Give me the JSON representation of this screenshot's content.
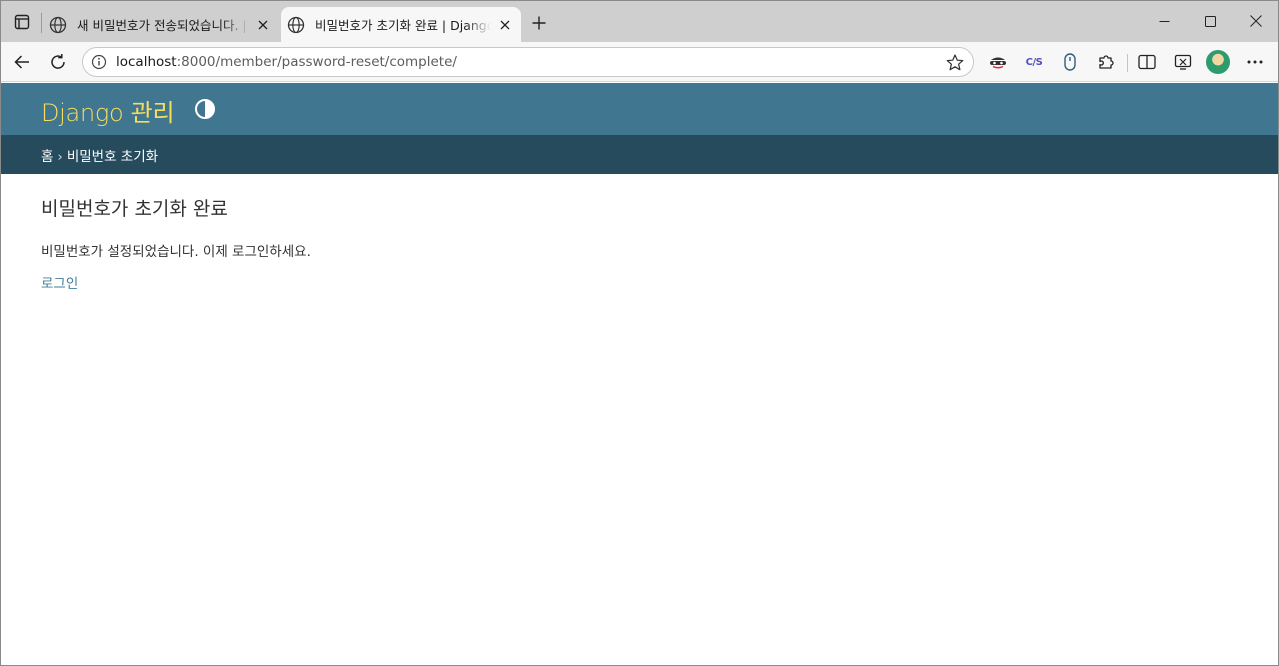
{
  "browser": {
    "tabs": [
      {
        "title": "새 비밀번호가 전송되었습니다. | D",
        "active": false
      },
      {
        "title": "비밀번호가 초기화 완료 | Django",
        "active": true
      }
    ],
    "address": {
      "host": "localhost",
      "path": ":8000/member/password-reset/complete/"
    }
  },
  "site": {
    "branding": "Django 관리",
    "breadcrumbs": {
      "home": "홈",
      "separator": "›",
      "current": "비밀번호 초기화"
    }
  },
  "content": {
    "title": "비밀번호가 초기화 완료",
    "message": "비밀번호가 설정되었습니다. 이제 로그인하세요.",
    "login_link": "로그인"
  },
  "colors": {
    "header_bg": "#417690",
    "branding_text": "#f5dd5d",
    "breadcrumbs_bg": "#264b5d",
    "link": "#447e9b"
  }
}
